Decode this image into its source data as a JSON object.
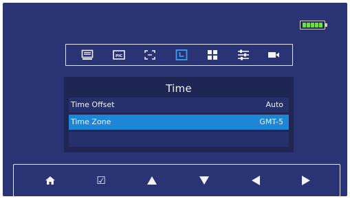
{
  "status": {
    "battery_icon": "battery-full-icon",
    "battery_color": "#6fe03a"
  },
  "tabs": [
    {
      "icon": "monitor-icon"
    },
    {
      "icon": "pic-icon",
      "label": "PIC"
    },
    {
      "icon": "screen-fit-icon"
    },
    {
      "icon": "clock-icon",
      "active": true
    },
    {
      "icon": "grid-icon"
    },
    {
      "icon": "sliders-icon"
    },
    {
      "icon": "camera-icon"
    }
  ],
  "panel": {
    "title": "Time",
    "rows": [
      {
        "label": "Time Offset",
        "value": "Auto",
        "selected": false
      },
      {
        "label": "Time Zone",
        "value": "GMT-5",
        "selected": true
      }
    ]
  },
  "nav": [
    {
      "icon": "home-icon"
    },
    {
      "icon": "checkbox-icon",
      "glyph": "☑"
    },
    {
      "icon": "arrow-up-icon"
    },
    {
      "icon": "arrow-down-icon"
    },
    {
      "icon": "arrow-left-icon"
    },
    {
      "icon": "arrow-right-icon"
    }
  ],
  "colors": {
    "background": "#2a3474",
    "panel": "#1f2654",
    "row": "#26306a",
    "selected_row": "#1d86d6",
    "active_tab": "#3aa0f0",
    "text": "#f1f3fa"
  }
}
